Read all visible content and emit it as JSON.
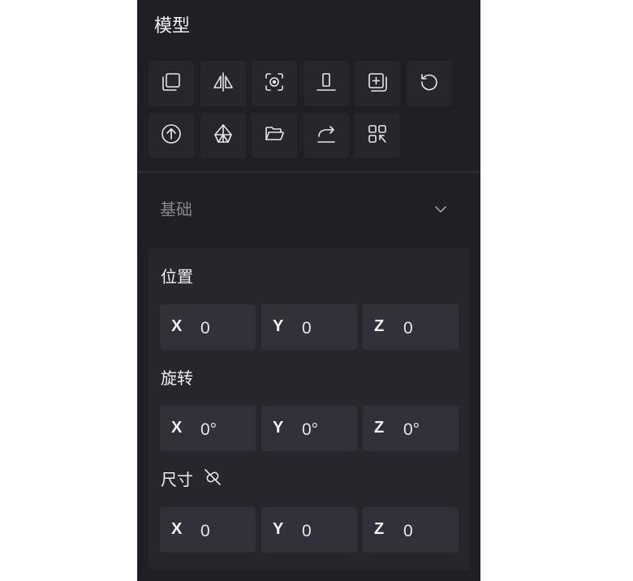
{
  "panel": {
    "title": "模型",
    "toolbar": {
      "row1": [
        {
          "icon": "duplicate-icon"
        },
        {
          "icon": "mirror-icon"
        },
        {
          "icon": "focus-icon"
        },
        {
          "icon": "align-bottom-icon"
        },
        {
          "icon": "add-copy-icon"
        },
        {
          "icon": "rotate-reset-icon"
        }
      ],
      "row2": [
        {
          "icon": "upload-icon"
        },
        {
          "icon": "lay-flat-icon"
        },
        {
          "icon": "open-folder-icon"
        },
        {
          "icon": "export-icon"
        },
        {
          "icon": "arrange-icon"
        }
      ]
    },
    "section": {
      "title": "基础",
      "expanded": true
    },
    "position": {
      "label": "位置",
      "x_label": "X",
      "x": "0",
      "y_label": "Y",
      "y": "0",
      "z_label": "Z",
      "z": "0"
    },
    "rotation": {
      "label": "旋转",
      "x_label": "X",
      "x": "0°",
      "y_label": "Y",
      "y": "0°",
      "z_label": "Z",
      "z": "0°"
    },
    "size": {
      "label": "尺寸",
      "lock_icon": "unlink-icon",
      "x_label": "X",
      "x": "0",
      "y_label": "Y",
      "y": "0",
      "z_label": "Z",
      "z": "0"
    }
  },
  "colors": {
    "panel_bg": "#1e2026",
    "button_bg": "#25272d",
    "field_bg": "#2f3239",
    "muted_text": "#84878e"
  }
}
